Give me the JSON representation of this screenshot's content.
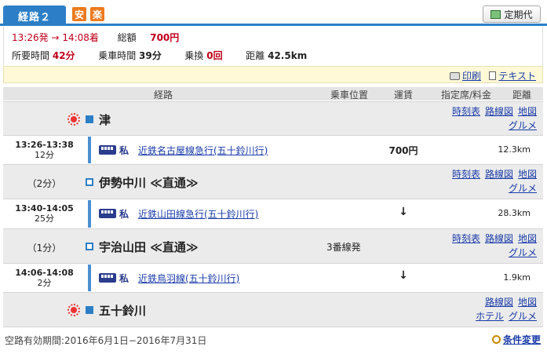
{
  "header": {
    "route_tab": "経路２",
    "badges": [
      "安",
      "楽"
    ],
    "teiki_button": "定期代"
  },
  "summary": {
    "depart": "13:26発",
    "arrow": "→",
    "arrive": "14:08着",
    "total_label": "総額",
    "total_value": "700円",
    "duration_label": "所要時間",
    "duration_value": "42分",
    "ride_label": "乗車時間",
    "ride_value": "39分",
    "transfer_label": "乗換",
    "transfer_value": "0回",
    "distance_label": "距離",
    "distance_value": "42.5km"
  },
  "toolbar": {
    "print": "印刷",
    "text": "テキスト"
  },
  "table_header": {
    "route": "経路",
    "position": "乗車位置",
    "fare": "運賃",
    "reserved": "指定席/料金",
    "distance": "距離"
  },
  "stations": [
    {
      "name": "津",
      "links": [
        "時刻表",
        "路線図",
        "地図",
        "グルメ"
      ]
    },
    {
      "name": "伊勢中川 ≪直通≫",
      "wait": "（2分）",
      "links": [
        "時刻表",
        "路線図",
        "地図",
        "グルメ"
      ]
    },
    {
      "name": "宇治山田 ≪直通≫",
      "wait": "（1分）",
      "platform": "3番線発",
      "links": [
        "時刻表",
        "路線図",
        "地図",
        "グルメ"
      ]
    },
    {
      "name": "五十鈴川",
      "links": [
        "路線図",
        "地図",
        "ホテル",
        "グルメ"
      ]
    }
  ],
  "segments": [
    {
      "time": "13:26-13:38",
      "duration": "12分",
      "type": "私",
      "line": "近鉄名古屋線急行(五十鈴川行)",
      "fare": "700円",
      "distance": "12.3km"
    },
    {
      "time": "13:40-14:05",
      "duration": "25分",
      "type": "私",
      "line": "近鉄山田線急行(五十鈴川行)",
      "fare": "↓",
      "distance": "28.3km"
    },
    {
      "time": "14:06-14:08",
      "duration": "2分",
      "type": "私",
      "line": "近鉄鳥羽線(五十鈴川行)",
      "fare": "↓",
      "distance": "1.9km"
    }
  ],
  "footer": {
    "validity": "空路有効期間:2016年6月1日−2016年7月31日",
    "change_conditions": "条件変更"
  }
}
